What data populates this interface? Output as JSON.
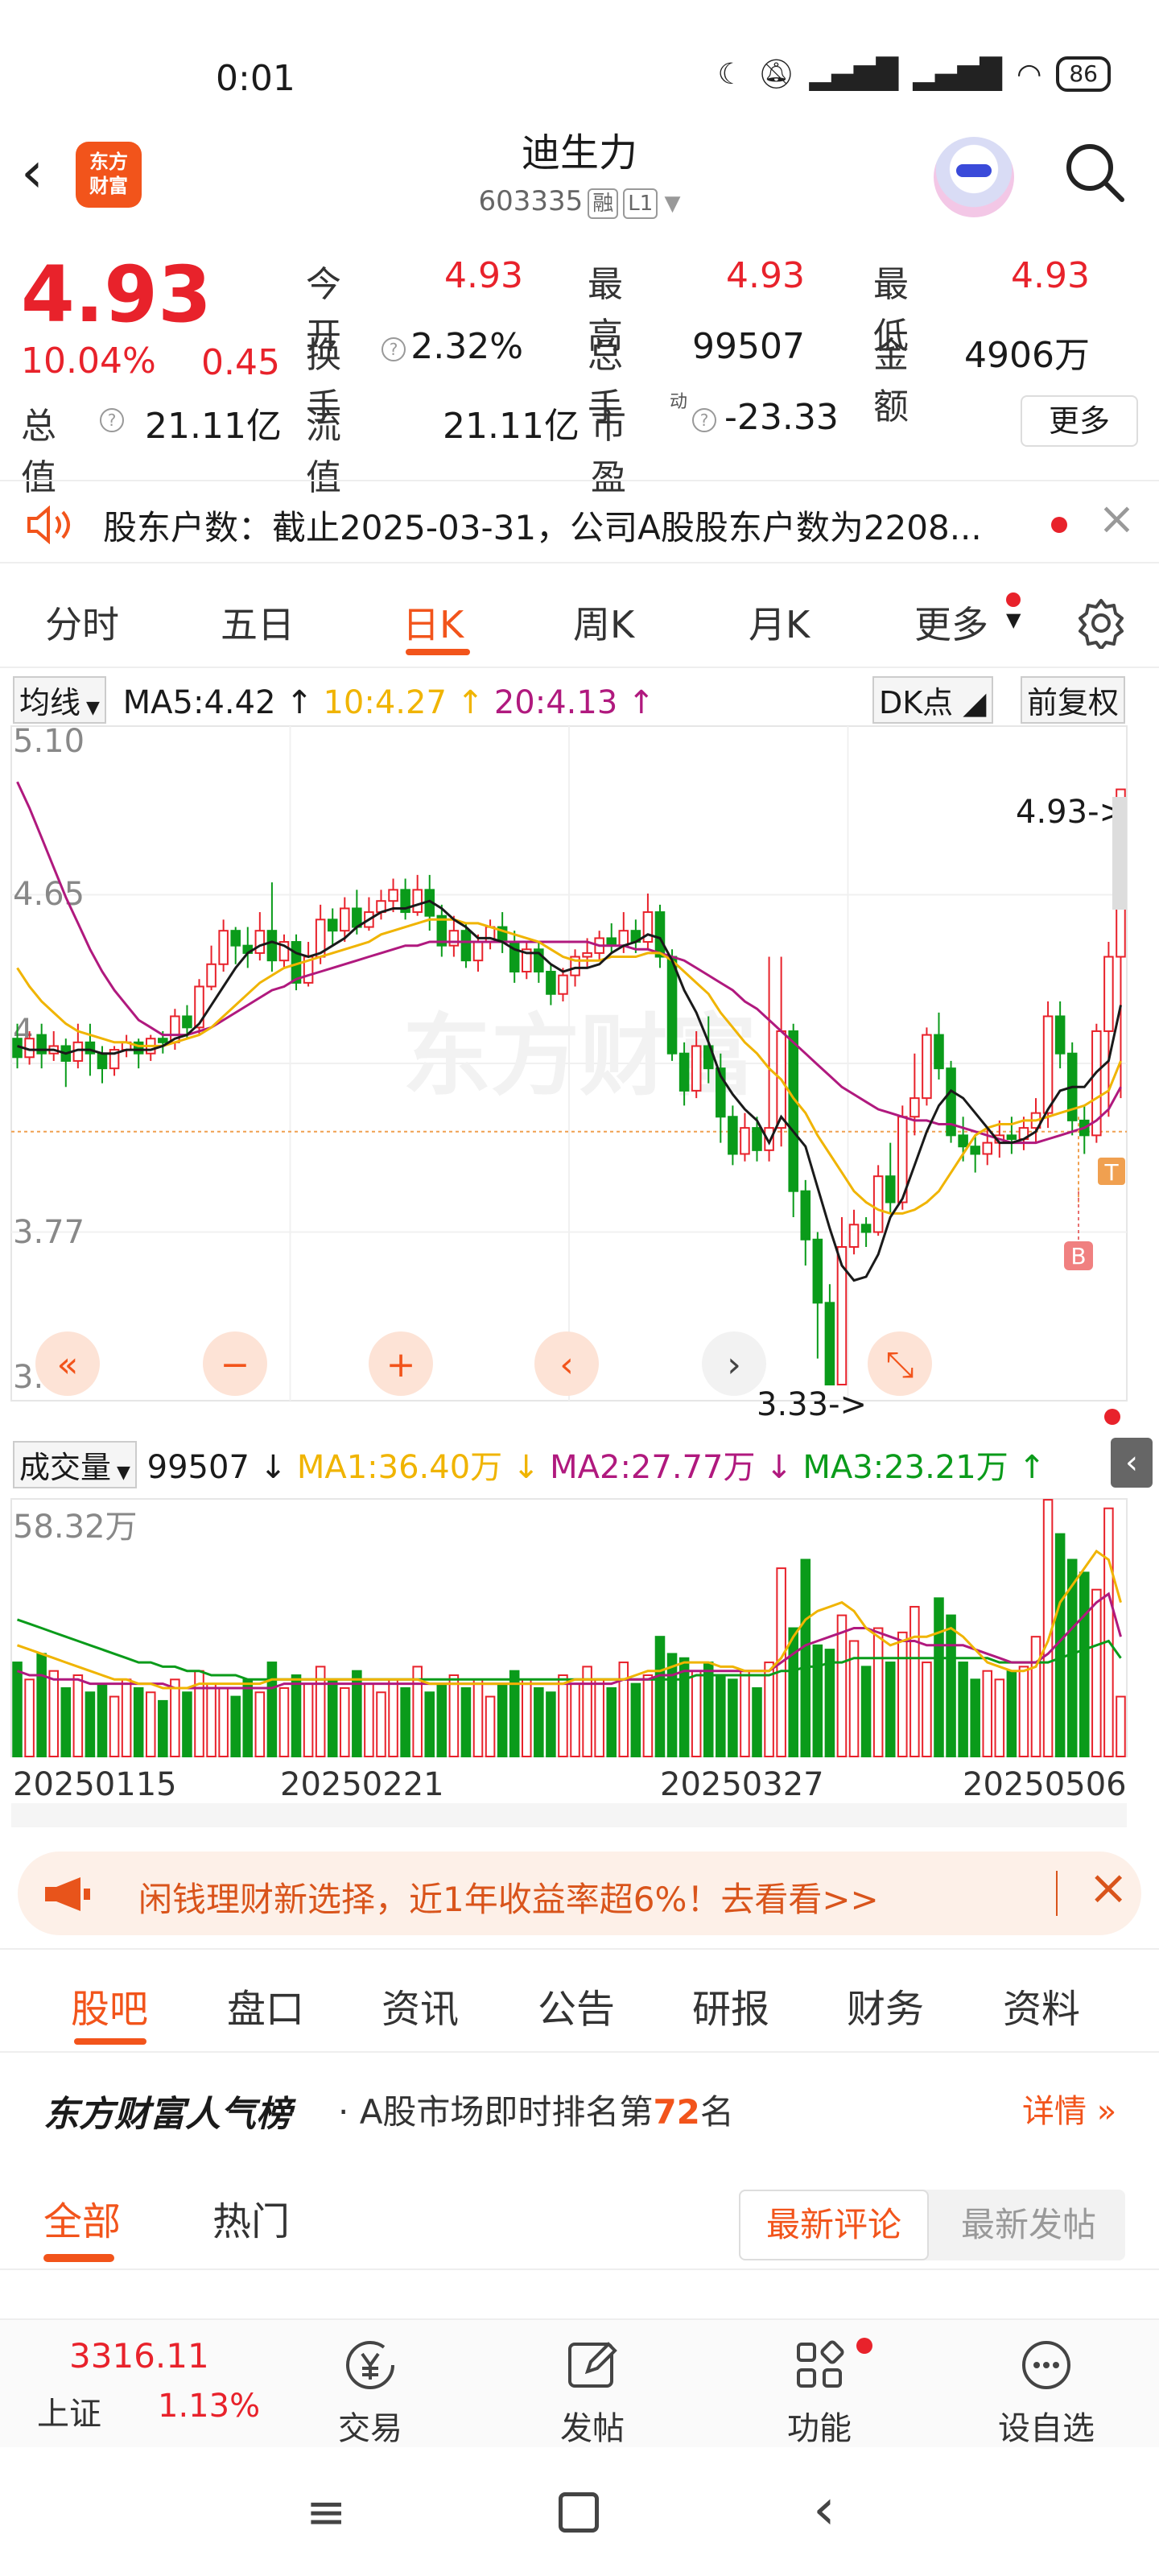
{
  "status_bar": {
    "time": "0:01",
    "battery": "86"
  },
  "header": {
    "logo_text": "东方\n财富",
    "name": "迪生力",
    "code": "603335",
    "tags": [
      "融",
      "L1"
    ]
  },
  "quote": {
    "price": "4.93",
    "change_pct": "10.04%",
    "change": "0.45",
    "rows": [
      [
        {
          "label": "今开",
          "value": "4.93",
          "red": true
        },
        {
          "label": "最高",
          "value": "4.93",
          "red": true
        },
        {
          "label": "最低",
          "value": "4.93",
          "red": true
        }
      ],
      [
        {
          "label": "换手",
          "value": "2.32%",
          "q": true
        },
        {
          "label": "总手",
          "value": "99507"
        },
        {
          "label": "金额",
          "value": "4906万"
        }
      ],
      [
        {
          "label": "总值",
          "value": "21.11亿",
          "q": true
        },
        {
          "label": "流值",
          "value": "21.11亿"
        },
        {
          "label": "市盈",
          "value": "-23.33",
          "q": true,
          "sup": "动"
        }
      ]
    ],
    "more": "更多"
  },
  "notice": {
    "text": "股东户数：截止2025-03-31，公司A股股东户数为2208..."
  },
  "chart_tabs": [
    "分时",
    "五日",
    "日K",
    "周K",
    "月K",
    "更多"
  ],
  "chart_tabs_active": 2,
  "ma_bar": {
    "type": "均线",
    "ma5": "MA5:4.42 ↑",
    "ma10": "10:4.27 ↑",
    "ma20": "20:4.13 ↑",
    "dk": "DK点",
    "adj": "前复权"
  },
  "price_axis": [
    "5.10",
    "4.65",
    "4.",
    "3.77",
    "3.33"
  ],
  "annotations": {
    "high": "4.93->",
    "low": "3.33->",
    "t": "T",
    "b": "B",
    "watermark": "东方财富"
  },
  "vol_bar": {
    "type": "成交量",
    "vol": "99507 ↓",
    "ma1": "MA1:36.40万 ↓",
    "ma2": "MA2:27.77万 ↓",
    "ma3": "MA3:23.21万 ↑",
    "max": "58.32万"
  },
  "dates": [
    "20250115",
    "20250221",
    "20250327",
    "20250506"
  ],
  "colors": {
    "up": "#e8222b",
    "down": "#0a9b1a",
    "ma5": "#1a1a1a",
    "ma10": "#f0b400",
    "ma20": "#b0197e",
    "accent": "#f2541b"
  },
  "chart_data": {
    "type": "candlestick",
    "ylim": [
      3.33,
      5.1
    ],
    "candles": [
      [
        4.26,
        4.21,
        4.3,
        4.18
      ],
      [
        4.21,
        4.26,
        4.28,
        4.19
      ],
      [
        4.27,
        4.22,
        4.3,
        4.18
      ],
      [
        4.22,
        4.24,
        4.28,
        4.2
      ],
      [
        4.24,
        4.2,
        4.26,
        4.13
      ],
      [
        4.2,
        4.25,
        4.3,
        4.18
      ],
      [
        4.25,
        4.22,
        4.3,
        4.16
      ],
      [
        4.22,
        4.18,
        4.24,
        4.14
      ],
      [
        4.18,
        4.23,
        4.24,
        4.16
      ],
      [
        4.23,
        4.25,
        4.27,
        4.21
      ],
      [
        4.25,
        4.22,
        4.26,
        4.18
      ],
      [
        4.22,
        4.26,
        4.27,
        4.2
      ],
      [
        4.26,
        4.25,
        4.28,
        4.22
      ],
      [
        4.25,
        4.32,
        4.34,
        4.23
      ],
      [
        4.32,
        4.29,
        4.35,
        4.26
      ],
      [
        4.29,
        4.4,
        4.42,
        4.27
      ],
      [
        4.4,
        4.46,
        4.51,
        4.39
      ],
      [
        4.46,
        4.55,
        4.58,
        4.44
      ],
      [
        4.55,
        4.51,
        4.56,
        4.46
      ],
      [
        4.51,
        4.49,
        4.56,
        4.45
      ],
      [
        4.49,
        4.55,
        4.6,
        4.47
      ],
      [
        4.55,
        4.47,
        4.68,
        4.44
      ],
      [
        4.47,
        4.52,
        4.54,
        4.45
      ],
      [
        4.52,
        4.41,
        4.54,
        4.39
      ],
      [
        4.41,
        4.48,
        4.52,
        4.4
      ],
      [
        4.48,
        4.58,
        4.62,
        4.46
      ],
      [
        4.58,
        4.55,
        4.61,
        4.51
      ],
      [
        4.55,
        4.61,
        4.64,
        4.52
      ],
      [
        4.61,
        4.56,
        4.66,
        4.54
      ],
      [
        4.56,
        4.6,
        4.64,
        4.55
      ],
      [
        4.6,
        4.63,
        4.66,
        4.58
      ],
      [
        4.63,
        4.66,
        4.69,
        4.6
      ],
      [
        4.66,
        4.6,
        4.69,
        4.58
      ],
      [
        4.6,
        4.66,
        4.7,
        4.59
      ],
      [
        4.66,
        4.59,
        4.7,
        4.55
      ],
      [
        4.59,
        4.51,
        4.62,
        4.48
      ],
      [
        4.51,
        4.55,
        4.59,
        4.48
      ],
      [
        4.55,
        4.47,
        4.57,
        4.45
      ],
      [
        4.47,
        4.52,
        4.54,
        4.44
      ],
      [
        4.52,
        4.56,
        4.58,
        4.5
      ],
      [
        4.56,
        4.52,
        4.6,
        4.49
      ],
      [
        4.52,
        4.44,
        4.55,
        4.41
      ],
      [
        4.44,
        4.5,
        4.52,
        4.42
      ],
      [
        4.5,
        4.44,
        4.52,
        4.41
      ],
      [
        4.44,
        4.38,
        4.46,
        4.35
      ],
      [
        4.38,
        4.43,
        4.45,
        4.36
      ],
      [
        4.43,
        4.48,
        4.5,
        4.4
      ],
      [
        4.48,
        4.49,
        4.53,
        4.45
      ],
      [
        4.49,
        4.53,
        4.55,
        4.47
      ],
      [
        4.53,
        4.51,
        4.57,
        4.49
      ],
      [
        4.51,
        4.55,
        4.6,
        4.49
      ],
      [
        4.55,
        4.52,
        4.58,
        4.49
      ],
      [
        4.52,
        4.6,
        4.65,
        4.5
      ],
      [
        4.6,
        4.48,
        4.62,
        4.45
      ],
      [
        4.48,
        4.22,
        4.5,
        4.2
      ],
      [
        4.22,
        4.12,
        4.25,
        4.08
      ],
      [
        4.12,
        4.24,
        4.28,
        4.1
      ],
      [
        4.24,
        4.18,
        4.32,
        4.14
      ],
      [
        4.18,
        4.05,
        4.22,
        3.98
      ],
      [
        4.05,
        3.95,
        4.08,
        3.92
      ],
      [
        3.95,
        4.02,
        4.06,
        3.93
      ],
      [
        4.02,
        3.96,
        4.05,
        3.93
      ],
      [
        3.96,
        4.02,
        4.48,
        3.93
      ],
      [
        4.02,
        4.28,
        4.48,
        3.97
      ],
      [
        4.28,
        3.85,
        4.3,
        3.78
      ],
      [
        3.85,
        3.72,
        3.88,
        3.65
      ],
      [
        3.72,
        3.55,
        3.74,
        3.4
      ],
      [
        3.55,
        3.33,
        3.6,
        3.33
      ],
      [
        3.33,
        3.7,
        3.78,
        3.33
      ],
      [
        3.7,
        3.76,
        3.8,
        3.68
      ],
      [
        3.76,
        3.74,
        3.78,
        3.7
      ],
      [
        3.74,
        3.89,
        3.92,
        3.73
      ],
      [
        3.89,
        3.82,
        3.98,
        3.79
      ],
      [
        3.82,
        4.05,
        4.08,
        3.8
      ],
      [
        4.05,
        4.1,
        4.22,
        4.0
      ],
      [
        4.1,
        4.27,
        4.29,
        4.08
      ],
      [
        4.27,
        4.18,
        4.33,
        4.15
      ],
      [
        4.18,
        4.0,
        4.2,
        3.98
      ],
      [
        4.0,
        3.97,
        4.05,
        3.93
      ],
      [
        3.97,
        3.95,
        4.0,
        3.9
      ],
      [
        3.95,
        3.98,
        4.02,
        3.92
      ],
      [
        3.98,
        4.0,
        4.04,
        3.94
      ],
      [
        4.0,
        3.99,
        4.05,
        3.95
      ],
      [
        3.99,
        4.02,
        4.05,
        3.96
      ],
      [
        4.02,
        4.06,
        4.1,
        3.98
      ],
      [
        4.06,
        4.32,
        4.36,
        4.02
      ],
      [
        4.32,
        4.22,
        4.36,
        4.18
      ],
      [
        4.22,
        4.04,
        4.25,
        4.0
      ],
      [
        4.04,
        4.0,
        4.08,
        3.95
      ],
      [
        4.0,
        4.28,
        4.3,
        3.98
      ],
      [
        4.28,
        4.48,
        4.52,
        4.05
      ],
      [
        4.48,
        4.93,
        4.93,
        4.1
      ]
    ],
    "ma5": [
      4.24,
      4.23,
      4.23,
      4.23,
      4.22,
      4.23,
      4.23,
      4.22,
      4.22,
      4.23,
      4.23,
      4.23,
      4.24,
      4.26,
      4.27,
      4.3,
      4.35,
      4.4,
      4.45,
      4.49,
      4.51,
      4.52,
      4.51,
      4.49,
      4.48,
      4.49,
      4.51,
      4.53,
      4.56,
      4.58,
      4.6,
      4.61,
      4.61,
      4.62,
      4.63,
      4.61,
      4.58,
      4.56,
      4.53,
      4.53,
      4.52,
      4.5,
      4.49,
      4.49,
      4.46,
      4.44,
      4.45,
      4.45,
      4.46,
      4.49,
      4.51,
      4.52,
      4.54,
      4.53,
      4.47,
      4.39,
      4.33,
      4.25,
      4.16,
      4.11,
      4.07,
      4.04,
      3.98,
      4.05,
      4.01,
      3.97,
      3.86,
      3.75,
      3.65,
      3.61,
      3.62,
      3.68,
      3.78,
      3.83,
      3.92,
      4.01,
      4.08,
      4.12,
      4.1,
      4.06,
      4.02,
      3.98,
      3.98,
      3.99,
      4.01,
      4.07,
      4.12,
      4.13,
      4.13,
      4.17,
      4.2,
      4.35
    ],
    "ma10": [
      4.45,
      4.4,
      4.36,
      4.33,
      4.3,
      4.28,
      4.27,
      4.26,
      4.25,
      4.25,
      4.24,
      4.24,
      4.24,
      4.25,
      4.26,
      4.27,
      4.29,
      4.32,
      4.35,
      4.38,
      4.41,
      4.43,
      4.45,
      4.46,
      4.47,
      4.48,
      4.49,
      4.5,
      4.51,
      4.52,
      4.54,
      4.55,
      4.56,
      4.57,
      4.58,
      4.58,
      4.58,
      4.57,
      4.57,
      4.56,
      4.55,
      4.54,
      4.53,
      4.52,
      4.5,
      4.48,
      4.47,
      4.47,
      4.47,
      4.48,
      4.48,
      4.48,
      4.49,
      4.49,
      4.47,
      4.44,
      4.41,
      4.38,
      4.33,
      4.29,
      4.25,
      4.22,
      4.18,
      4.15,
      4.1,
      4.06,
      4.0,
      3.95,
      3.9,
      3.85,
      3.82,
      3.8,
      3.79,
      3.79,
      3.8,
      3.82,
      3.85,
      3.9,
      3.95,
      4.0,
      4.02,
      4.03,
      4.03,
      4.04,
      4.04,
      4.05,
      4.06,
      4.07,
      4.08,
      4.1,
      4.12,
      4.2
    ],
    "ma20": [
      4.95,
      4.88,
      4.8,
      4.72,
      4.64,
      4.57,
      4.5,
      4.44,
      4.39,
      4.35,
      4.31,
      4.29,
      4.27,
      4.27,
      4.27,
      4.28,
      4.29,
      4.31,
      4.33,
      4.35,
      4.37,
      4.39,
      4.4,
      4.42,
      4.43,
      4.44,
      4.45,
      4.46,
      4.47,
      4.48,
      4.49,
      4.5,
      4.51,
      4.51,
      4.52,
      4.52,
      4.52,
      4.52,
      4.52,
      4.52,
      4.52,
      4.52,
      4.52,
      4.52,
      4.52,
      4.52,
      4.52,
      4.52,
      4.51,
      4.51,
      4.51,
      4.5,
      4.5,
      4.49,
      4.48,
      4.47,
      4.45,
      4.43,
      4.41,
      4.39,
      4.36,
      4.34,
      4.31,
      4.28,
      4.25,
      4.22,
      4.19,
      4.16,
      4.13,
      4.11,
      4.09,
      4.07,
      4.06,
      4.05,
      4.04,
      4.04,
      4.03,
      4.03,
      4.02,
      4.01,
      4.0,
      3.99,
      3.98,
      3.98,
      3.98,
      3.99,
      4.0,
      4.01,
      4.02,
      4.04,
      4.07,
      4.13
    ],
    "volume": [
      22,
      18,
      24,
      20,
      16,
      19,
      15,
      17,
      14,
      18,
      16,
      15,
      13,
      18,
      15,
      20,
      17,
      16,
      14,
      18,
      15,
      22,
      16,
      19,
      17,
      21,
      18,
      16,
      20,
      17,
      15,
      18,
      16,
      21,
      15,
      17,
      19,
      16,
      18,
      14,
      17,
      20,
      18,
      16,
      15,
      19,
      17,
      21,
      18,
      16,
      22,
      17,
      19,
      28,
      24,
      23,
      20,
      22,
      19,
      18,
      20,
      16,
      22,
      44,
      30,
      46,
      26,
      25,
      33,
      27,
      21,
      30,
      22,
      29,
      35,
      22,
      37,
      33,
      22,
      18,
      20,
      18,
      20,
      21,
      28,
      60,
      52,
      46,
      43,
      39,
      58,
      14
    ],
    "vol_ma1": [
      26,
      25,
      24,
      23,
      22,
      21,
      20,
      19,
      18,
      18,
      17,
      17,
      16,
      16,
      16,
      17,
      17,
      17,
      17,
      17,
      17,
      18,
      18,
      18,
      18,
      18,
      18,
      18,
      18,
      18,
      18,
      18,
      18,
      18,
      17,
      17,
      17,
      17,
      17,
      17,
      17,
      17,
      17,
      17,
      17,
      17,
      18,
      18,
      18,
      18,
      18,
      19,
      20,
      20,
      21,
      22,
      22,
      22,
      21,
      21,
      20,
      20,
      20,
      23,
      28,
      32,
      34,
      35,
      36,
      34,
      30,
      28,
      26,
      27,
      28,
      28,
      29,
      30,
      28,
      25,
      22,
      21,
      20,
      20,
      21,
      27,
      36,
      40,
      44,
      48,
      46,
      36
    ],
    "vol_ma2": [
      20,
      19,
      19,
      18,
      18,
      18,
      17,
      17,
      17,
      17,
      17,
      17,
      17,
      16,
      16,
      16,
      16,
      16,
      16,
      16,
      16,
      16,
      17,
      17,
      17,
      17,
      17,
      17,
      17,
      17,
      17,
      17,
      17,
      17,
      17,
      17,
      17,
      17,
      17,
      17,
      17,
      17,
      17,
      17,
      17,
      17,
      17,
      17,
      17,
      17,
      18,
      18,
      18,
      19,
      19,
      20,
      20,
      20,
      20,
      20,
      20,
      20,
      20,
      22,
      24,
      26,
      27,
      28,
      29,
      30,
      30,
      29,
      28,
      27,
      27,
      26,
      26,
      26,
      26,
      25,
      24,
      23,
      22,
      22,
      22,
      24,
      27,
      30,
      33,
      36,
      38,
      28
    ],
    "vol_ma3": [
      32,
      31,
      30,
      29,
      28,
      27,
      26,
      25,
      24,
      23,
      22,
      22,
      21,
      21,
      20,
      20,
      19,
      19,
      19,
      18,
      18,
      18,
      18,
      18,
      18,
      18,
      18,
      18,
      18,
      18,
      18,
      18,
      18,
      18,
      18,
      18,
      18,
      18,
      18,
      18,
      18,
      18,
      18,
      18,
      18,
      18,
      18,
      18,
      18,
      18,
      18,
      18,
      18,
      18,
      18,
      18,
      19,
      19,
      19,
      19,
      19,
      19,
      19,
      20,
      20,
      21,
      21,
      22,
      22,
      23,
      23,
      23,
      23,
      23,
      23,
      23,
      23,
      23,
      23,
      23,
      23,
      22,
      22,
      22,
      22,
      22,
      23,
      24,
      25,
      26,
      27,
      23
    ]
  },
  "promo": {
    "text": "闲钱理财新选择，近1年收益率超6%！去看看>>"
  },
  "section_tabs": [
    "股吧",
    "盘口",
    "资讯",
    "公告",
    "研报",
    "财务",
    "资料"
  ],
  "section_tabs_active": 0,
  "rank": {
    "title": "东方财富人气榜",
    "prefix": "A股市场即时排名第",
    "number": "72",
    "suffix": "名",
    "link": "详情"
  },
  "sub_tabs": [
    "全部",
    "热门"
  ],
  "sort_tabs": [
    "最新评论",
    "最新发帖"
  ],
  "bottom_nav": {
    "index_value": "3316.11",
    "index_name": "上证",
    "index_pct": "1.13%",
    "items": [
      "交易",
      "发帖",
      "功能",
      "设自选"
    ]
  }
}
